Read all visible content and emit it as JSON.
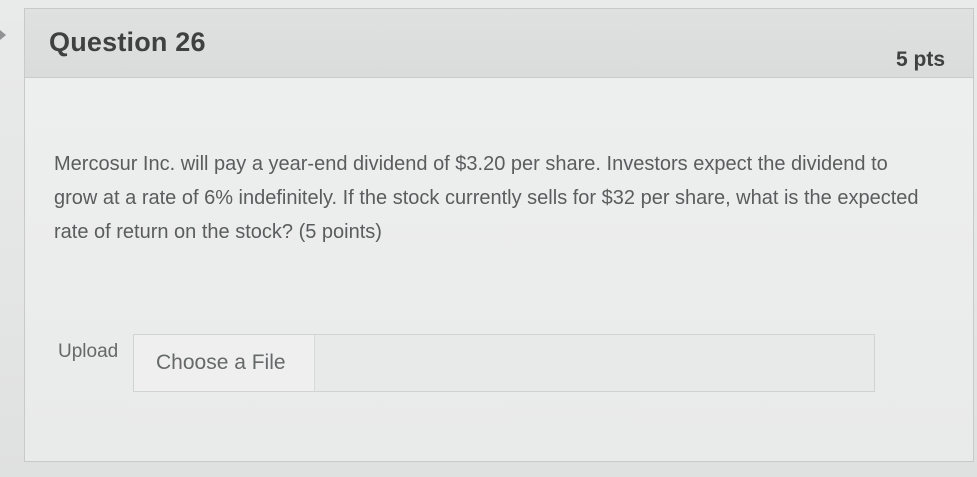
{
  "question": {
    "title": "Question 26",
    "points": "5 pts",
    "body": "Mercosur Inc. will pay a year-end dividend of $3.20 per share. Investors expect the dividend to grow at a rate of 6% indefinitely. If the stock currently sells for $32 per share, what is the expected rate of return on the stock? (5 points)"
  },
  "upload": {
    "label": "Upload",
    "button_label": "Choose a File",
    "selected_file": ""
  },
  "colors": {
    "header_background": "#dcdede",
    "text_primary": "#3f4141",
    "text_secondary": "#5a5d5d"
  }
}
